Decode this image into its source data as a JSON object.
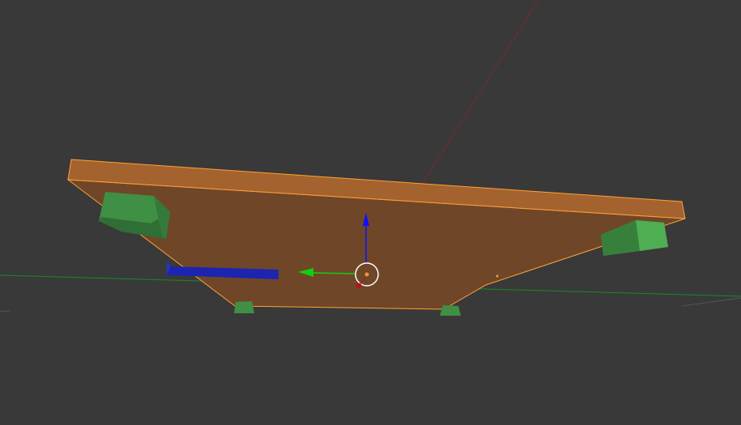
{
  "viewport": {
    "background_color": "#393939",
    "colors": {
      "plate_top": "#a4622f",
      "plate_bottom": "#6f4628",
      "plate_outline": "#ffa133",
      "block_green": "#3f8f44",
      "block_green_light": "#4fae52",
      "block_green_dark": "#2f6e34",
      "bar_blue": "#1d24b0",
      "axis_x_red": "#7a2a2a",
      "axis_y_green": "#1c8a1c",
      "gizmo_z": "#0a12ff",
      "gizmo_y": "#11d011",
      "cursor_ring": "#ffffff"
    }
  }
}
